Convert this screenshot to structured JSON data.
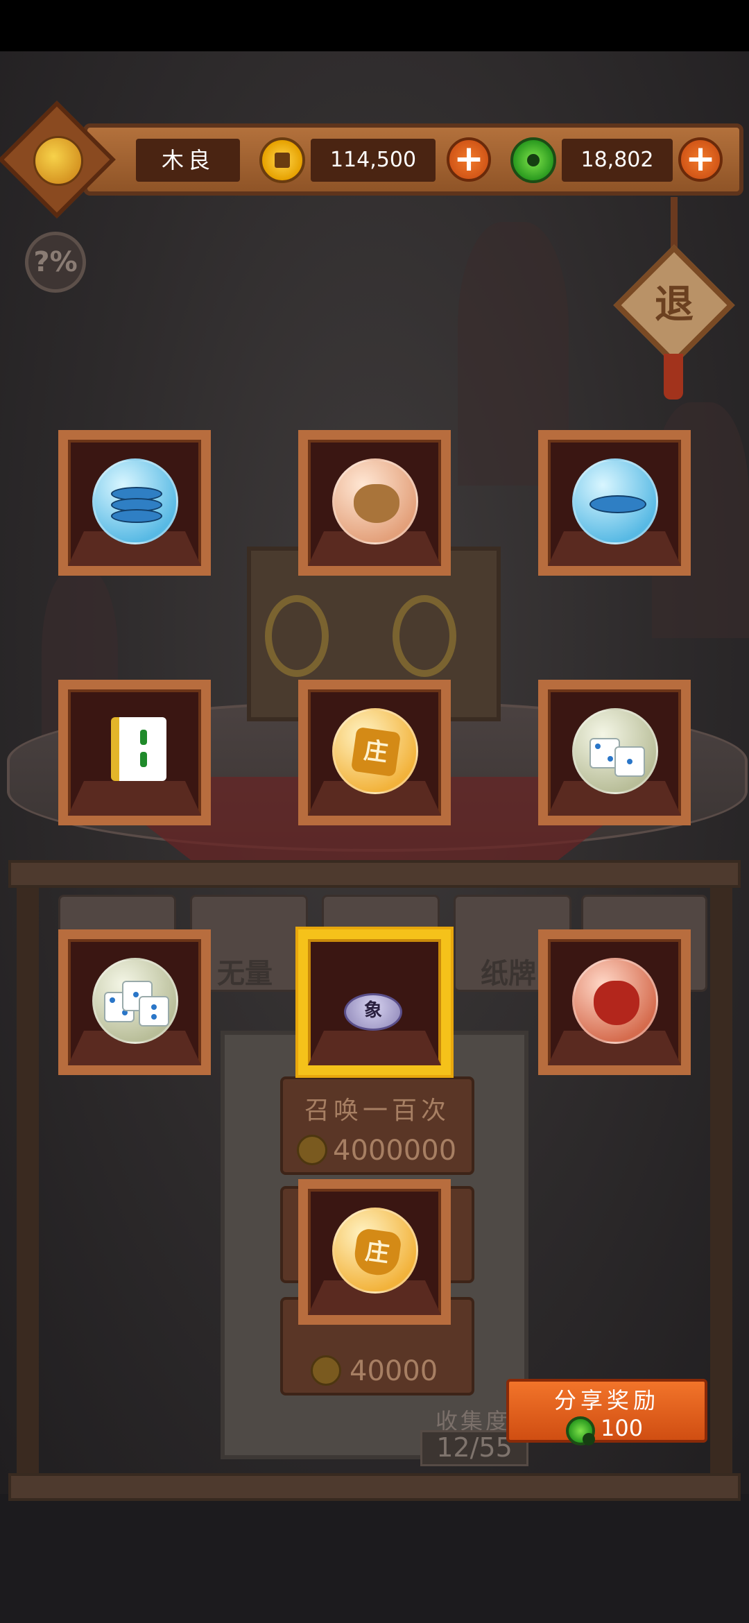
{
  "player": {
    "name": "木良"
  },
  "currency": {
    "gold": {
      "icon": "gold-coin-icon",
      "value": "114,500"
    },
    "jade": {
      "icon": "jade-coin-icon",
      "value": "18,802"
    }
  },
  "buttons": {
    "add_gold": "+",
    "add_jade": "+",
    "help": "?%",
    "exit": "退"
  },
  "items": [
    {
      "name": "blue-chips-stack",
      "orb": "orb-blue"
    },
    {
      "name": "money-bag",
      "orb": "orb-peach"
    },
    {
      "name": "blue-chip-single",
      "orb": "orb-blue"
    },
    {
      "name": "mahjong-tile",
      "orb": ""
    },
    {
      "name": "dealer-token",
      "orb": "orb-gold",
      "label": "庄"
    },
    {
      "name": "dice-pair",
      "orb": "orb-sage"
    },
    {
      "name": "dice-set",
      "orb": "orb-sage"
    },
    {
      "name": "chess-piece",
      "orb": "",
      "label": "象",
      "selected": true
    },
    {
      "name": "red-pouch",
      "orb": "orb-red"
    },
    {
      "name": "dealer-badge",
      "orb": "orb-gold",
      "label": "庄"
    }
  ],
  "posters": [
    {
      "text": ""
    },
    {
      "text": "无量"
    },
    {
      "text": ""
    },
    {
      "text": "纸牌"
    },
    {
      "text": ""
    }
  ],
  "summon": {
    "hundred": {
      "title": "召唤一百次",
      "cost": "4000000"
    },
    "single": {
      "cost": "40000"
    }
  },
  "collection": {
    "label": "收集度",
    "value": "12/55"
  },
  "share": {
    "label": "分享奖励",
    "reward": "100"
  }
}
